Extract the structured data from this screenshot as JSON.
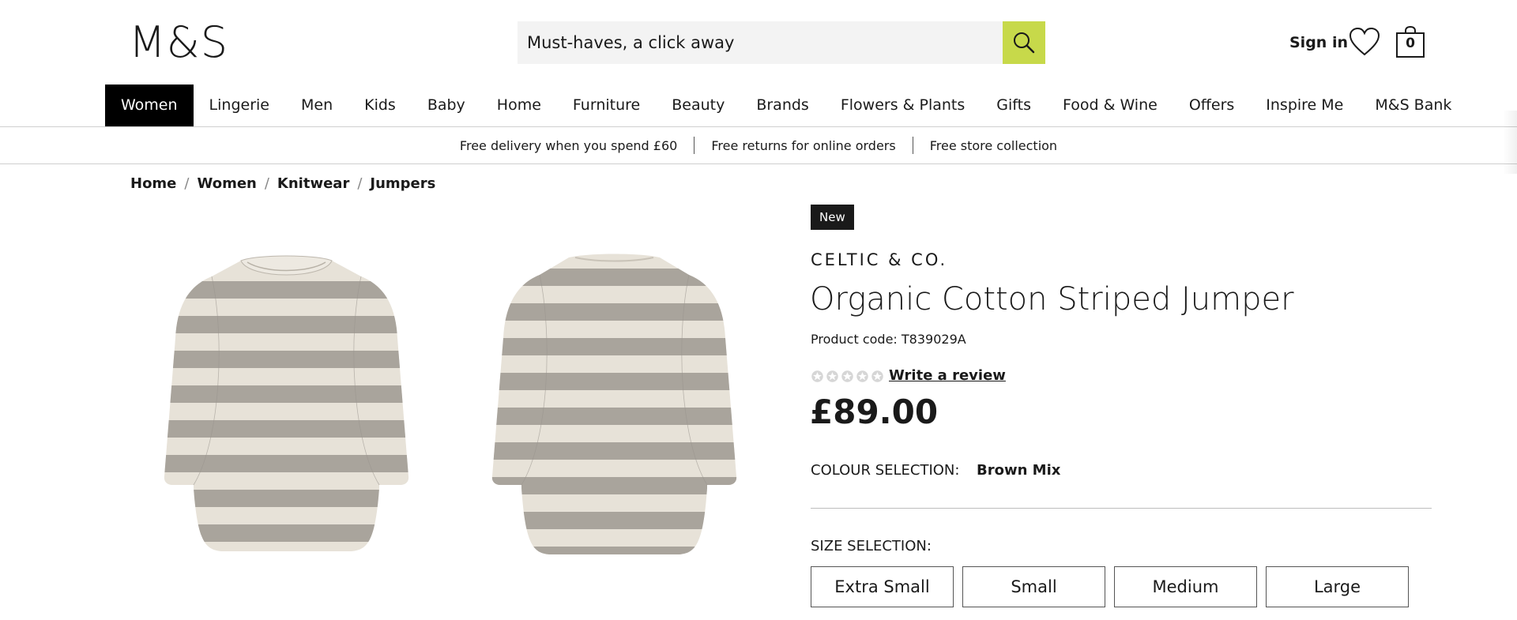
{
  "header": {
    "logo": "M&S",
    "search_placeholder": "Must-haves, a click away",
    "sign_in": "Sign in",
    "bag_count": "0"
  },
  "nav": {
    "items": [
      {
        "label": "Women",
        "active": true
      },
      {
        "label": "Lingerie"
      },
      {
        "label": "Men"
      },
      {
        "label": "Kids"
      },
      {
        "label": "Baby"
      },
      {
        "label": "Home"
      },
      {
        "label": "Furniture"
      },
      {
        "label": "Beauty"
      },
      {
        "label": "Brands"
      },
      {
        "label": "Flowers & Plants"
      },
      {
        "label": "Gifts"
      },
      {
        "label": "Food & Wine"
      },
      {
        "label": "Offers"
      },
      {
        "label": "Inspire Me"
      },
      {
        "label": "M&S Bank"
      }
    ]
  },
  "promo": {
    "items": [
      "Free delivery when you spend £60",
      "Free returns for online orders",
      "Free store collection"
    ]
  },
  "breadcrumb": [
    "Home",
    "Women",
    "Knitwear",
    "Jumpers"
  ],
  "product": {
    "badge": "New",
    "brand": "CELTIC & CO.",
    "title": "Organic Cotton Striped Jumper",
    "code": "Product code: T839029A",
    "rating": 0,
    "review_link": "Write a review",
    "price": "£89.00",
    "colour_label": "COLOUR SELECTION:",
    "colour_value": "Brown Mix",
    "size_label": "SIZE SELECTION:",
    "sizes": [
      "Extra Small",
      "Small",
      "Medium",
      "Large"
    ]
  },
  "colors": {
    "accent_search": "#c7d94a",
    "stripe_dark": "#a9a49c",
    "stripe_light": "#e7e2d8",
    "star_empty": "#d6d6d6"
  }
}
